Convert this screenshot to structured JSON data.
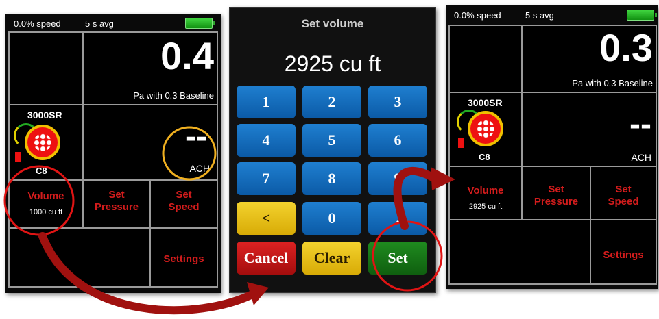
{
  "colors": {
    "accent_red": "#d21c1c",
    "keypad_blue": "#1266b8",
    "keypad_yellow": "#e6bd14",
    "keypad_green": "#157515",
    "highlight_red": "#e01414",
    "highlight_orange": "#f0b020"
  },
  "screen1": {
    "speed": "0.0% speed",
    "avg": "5 s avg",
    "pressure_value": "0.4",
    "baseline": "Pa with 0.3  Baseline",
    "model": "3000SR",
    "ring": "C8",
    "ach_value": "--",
    "ach_label": "ACH",
    "volume_label": "Volume",
    "volume_value": "1000 cu ft",
    "set_pressure_1": "Set",
    "set_pressure_2": "Pressure",
    "set_speed_1": "Set",
    "set_speed_2": "Speed",
    "settings": "Settings"
  },
  "keypad": {
    "title": "Set volume",
    "display": "2925 cu ft",
    "keys": [
      "1",
      "2",
      "3",
      "4",
      "5",
      "6",
      "7",
      "8",
      "9",
      "<",
      "0",
      "."
    ],
    "cancel": "Cancel",
    "clear": "Clear",
    "set": "Set"
  },
  "screen3": {
    "speed": "0.0% speed",
    "avg": "5 s avg",
    "pressure_value": "0.3",
    "baseline": "Pa with 0.3  Baseline",
    "model": "3000SR",
    "ring": "C8",
    "ach_value": "--",
    "ach_label": "ACH",
    "volume_label": "Volume",
    "volume_value": "2925 cu ft",
    "set_pressure_1": "Set",
    "set_pressure_2": "Pressure",
    "set_speed_1": "Set",
    "set_speed_2": "Speed",
    "settings": "Settings"
  }
}
